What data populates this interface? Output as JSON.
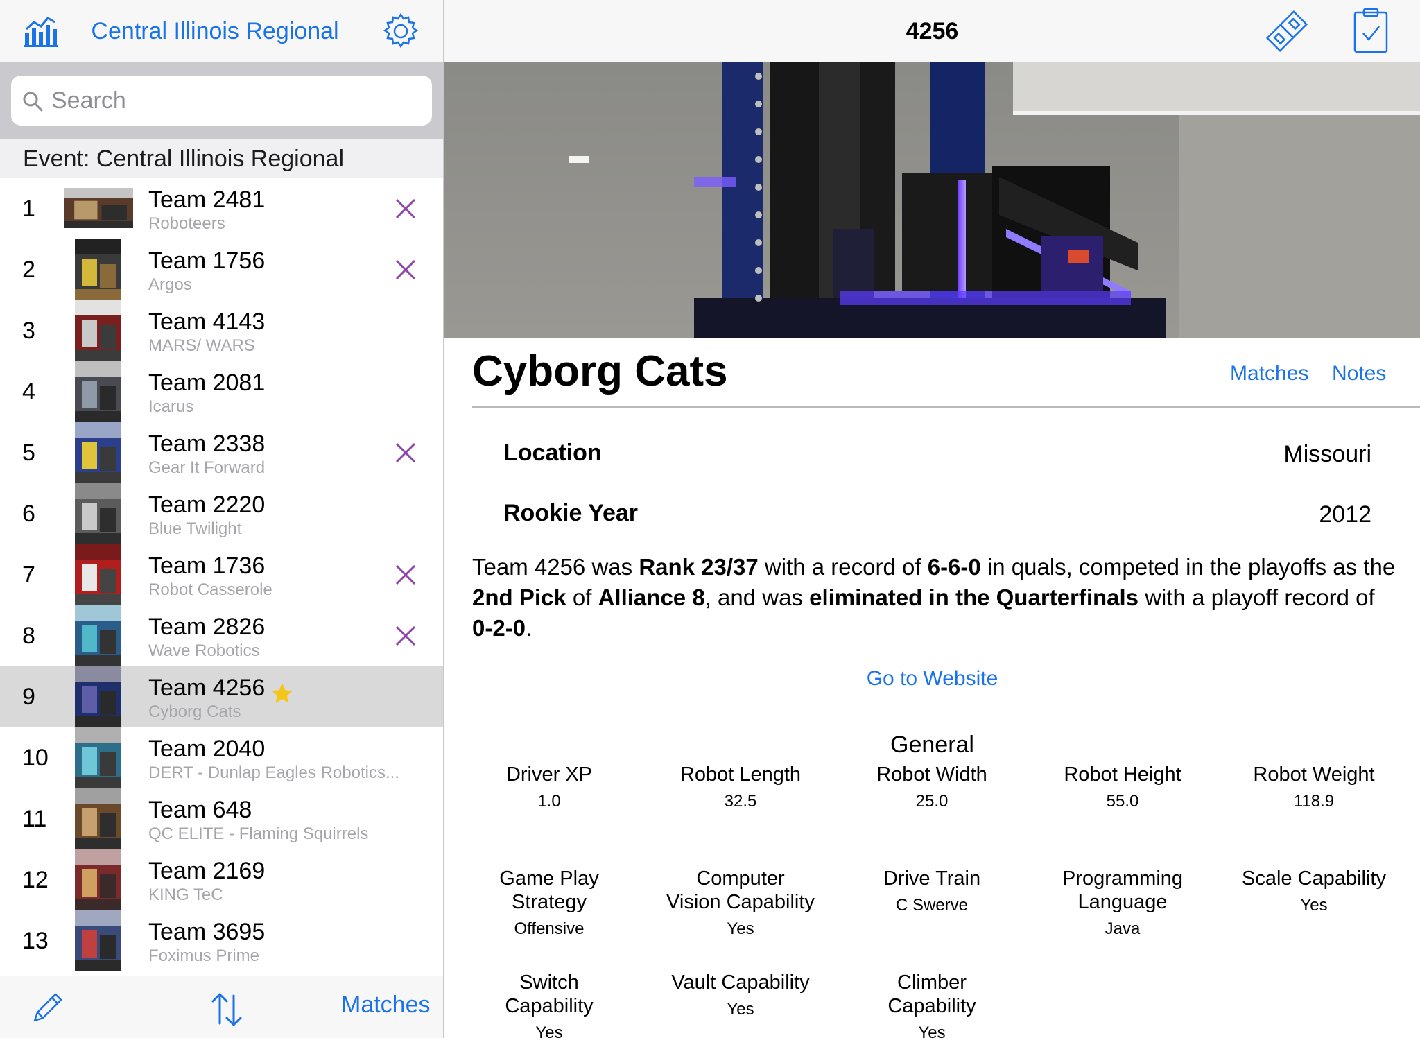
{
  "left_nav": {
    "title": "Central Illinois Regional"
  },
  "search": {
    "placeholder": "Search"
  },
  "section": {
    "header": "Event: Central Illinois Regional"
  },
  "teams": [
    {
      "rank": "1",
      "name": "Team 2481",
      "nickname": "Roboteers",
      "crossed": true
    },
    {
      "rank": "2",
      "name": "Team 1756",
      "nickname": "Argos",
      "crossed": true
    },
    {
      "rank": "3",
      "name": "Team 4143",
      "nickname": "MARS/ WARS",
      "crossed": false
    },
    {
      "rank": "4",
      "name": "Team 2081",
      "nickname": "Icarus",
      "crossed": false
    },
    {
      "rank": "5",
      "name": "Team 2338",
      "nickname": "Gear It Forward",
      "crossed": true
    },
    {
      "rank": "6",
      "name": "Team 2220",
      "nickname": "Blue Twilight",
      "crossed": false
    },
    {
      "rank": "7",
      "name": "Team 1736",
      "nickname": "Robot Casserole",
      "crossed": true
    },
    {
      "rank": "8",
      "name": "Team 2826",
      "nickname": "Wave Robotics",
      "crossed": true
    },
    {
      "rank": "9",
      "name": "Team 4256",
      "nickname": "Cyborg Cats",
      "crossed": false,
      "starred": true,
      "selected": true
    },
    {
      "rank": "10",
      "name": "Team 2040",
      "nickname": "DERT - Dunlap Eagles Robotics...",
      "crossed": false
    },
    {
      "rank": "11",
      "name": "Team 648",
      "nickname": "QC ELITE - Flaming Squirrels",
      "crossed": false
    },
    {
      "rank": "12",
      "name": "Team 2169",
      "nickname": "KING TeC",
      "crossed": false
    },
    {
      "rank": "13",
      "name": "Team 3695",
      "nickname": "Foximus Prime",
      "crossed": false
    }
  ],
  "left_toolbar": {
    "matches_label": "Matches"
  },
  "right_nav": {
    "title": "4256"
  },
  "detail": {
    "team_name": "Cyborg Cats",
    "matches_link": "Matches",
    "notes_link": "Notes",
    "location_label": "Location",
    "location_value": "Missouri",
    "rookie_label": "Rookie Year",
    "rookie_value": "2012",
    "summary": {
      "p1": "Team 4256 was ",
      "rank": "Rank 23/37",
      "p2": " with a record of ",
      "record": "6-6-0",
      "p3": " in quals, competed in the playoffs as the ",
      "pick": "2nd Pick",
      "p4": " of ",
      "alliance": "Alliance 8",
      "p5": ", and was ",
      "elim": "eliminated in the Quarterfinals",
      "p6": " with a playoff record of ",
      "playoff_record": "0-2-0",
      "p7": "."
    },
    "website_link": "Go to Website",
    "general_header": "General"
  },
  "stats": [
    {
      "label": "Driver XP",
      "value": "1.0"
    },
    {
      "label": "Robot Length",
      "value": "32.5"
    },
    {
      "label": "Robot Width",
      "value": "25.0"
    },
    {
      "label": "Robot Height",
      "value": "55.0"
    },
    {
      "label": "Robot Weight",
      "value": "118.9"
    },
    {
      "label": "Game Play\nStrategy",
      "value": "Offensive"
    },
    {
      "label": "Computer\nVision Capability",
      "value": "Yes"
    },
    {
      "label": "Drive Train",
      "value": "C Swerve"
    },
    {
      "label": "Programming\nLanguage",
      "value": "Java"
    },
    {
      "label": "Scale Capability",
      "value": "Yes"
    },
    {
      "label": "Switch\nCapability",
      "value": "Yes"
    },
    {
      "label": "Vault Capability",
      "value": "Yes"
    },
    {
      "label": "Climber\nCapability",
      "value": "Yes"
    }
  ],
  "colors": {
    "accent": "#1a73e8",
    "cross": "#8e44ad",
    "star": "#f5c518",
    "selected_row": "#d9d9d9"
  }
}
